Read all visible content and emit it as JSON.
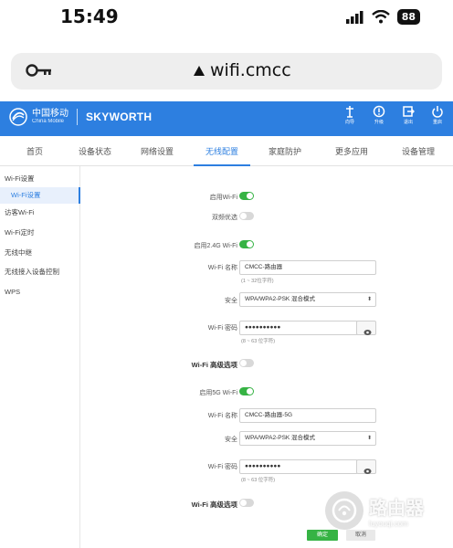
{
  "status_bar": {
    "time": "15:49",
    "battery": "88"
  },
  "browser": {
    "url": "wifi.cmcc"
  },
  "header": {
    "logo_cn": "中国移动",
    "logo_en": "China Mobile",
    "brand": "SKYWORTH",
    "actions": [
      {
        "label": "向导"
      },
      {
        "label": "升级"
      },
      {
        "label": "退出"
      },
      {
        "label": "重启"
      }
    ]
  },
  "nav_tabs": [
    "首页",
    "设备状态",
    "网络设置",
    "无线配置",
    "家庭防护",
    "更多应用",
    "设备管理"
  ],
  "sidebar": {
    "items": [
      {
        "label": "Wi-Fi设置"
      },
      {
        "label": "Wi-Fi设置"
      },
      {
        "label": "访客Wi-Fi"
      },
      {
        "label": "Wi-Fi定时"
      },
      {
        "label": "无线中继"
      },
      {
        "label": "无线接入设备控制"
      },
      {
        "label": "WPS"
      }
    ]
  },
  "wifi": {
    "enable_label": "启用Wi-Fi",
    "dual_band_label": "双频优选",
    "band24": {
      "enable_label": "启用2.4G Wi-Fi",
      "name_label": "Wi-Fi 名称",
      "name_value": "CMCC-路由器",
      "name_hint": "(1 ~ 32位字符)",
      "security_label": "安全",
      "security_value": "WPA/WPA2-PSK 混合模式",
      "password_label": "Wi-Fi 密码",
      "password_value": "●●●●●●●●●●",
      "password_hint": "(8 ~ 63 位字符)",
      "advanced_label": "Wi-Fi 高级选项"
    },
    "band5": {
      "enable_label": "启用5G Wi-Fi",
      "name_label": "Wi-Fi 名称",
      "name_value": "CMCC-路由器-5G",
      "security_label": "安全",
      "security_value": "WPA/WPA2-PSK 混合模式",
      "password_label": "Wi-Fi 密码",
      "password_value": "●●●●●●●●●●",
      "password_hint": "(8 ~ 63 位字符)",
      "advanced_label": "Wi-Fi 高级选项"
    },
    "buttons": {
      "save": "确定",
      "cancel": "取消"
    }
  },
  "watermark": {
    "main": "路由器",
    "sub": "luyouqi.com"
  },
  "colors": {
    "header_blue": "#2d7fe0",
    "toggle_green": "#36b344"
  }
}
